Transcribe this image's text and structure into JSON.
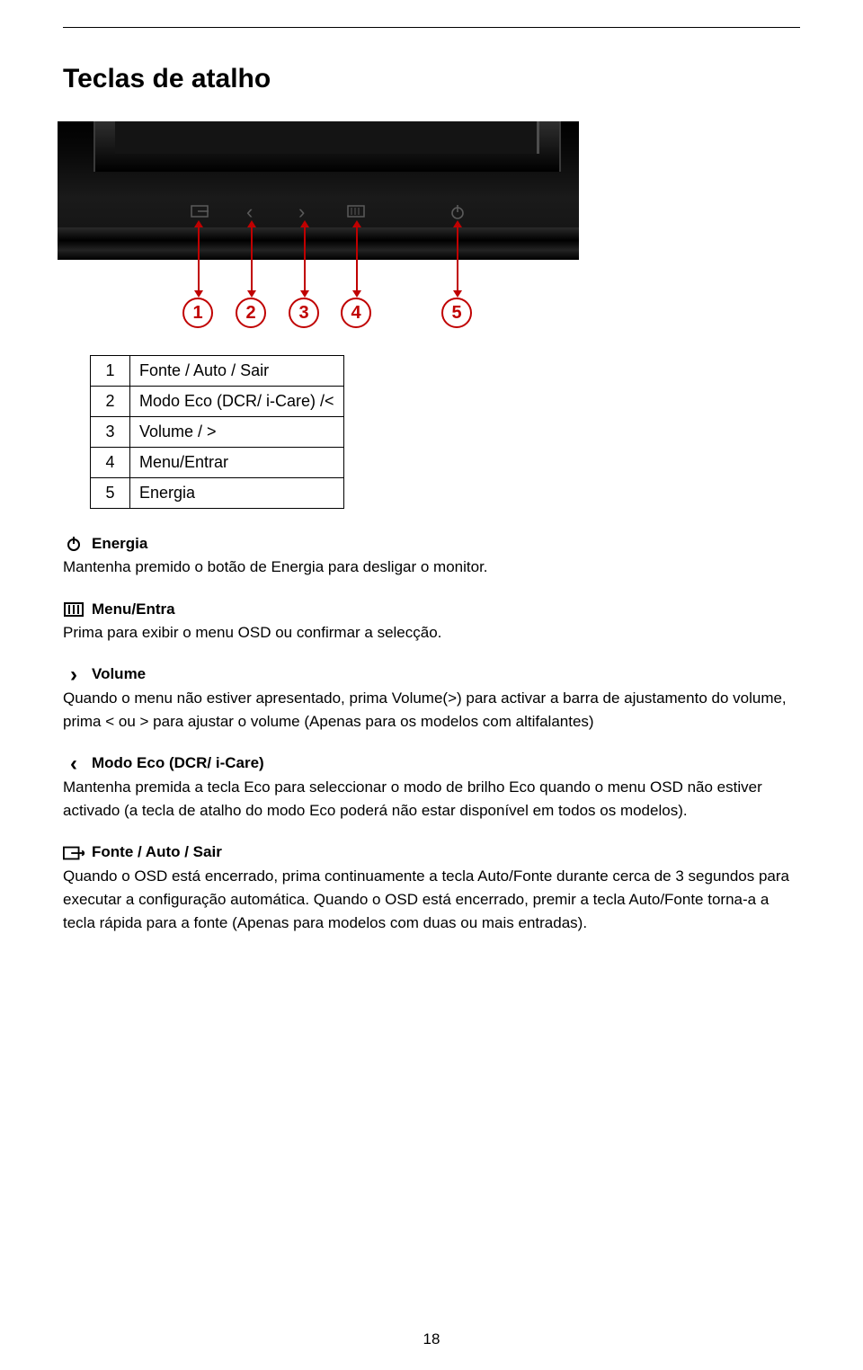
{
  "title": "Teclas de atalho",
  "callouts": [
    "1",
    "2",
    "3",
    "4",
    "5"
  ],
  "table": {
    "rows": [
      {
        "num": "1",
        "label": "Fonte / Auto / Sair"
      },
      {
        "num": "2",
        "label": "Modo Eco (DCR/ i-Care) /<"
      },
      {
        "num": "3",
        "label": "Volume / >"
      },
      {
        "num": "4",
        "label": "Menu/Entrar"
      },
      {
        "num": "5",
        "label": "Energia"
      }
    ]
  },
  "sections": {
    "energia": {
      "title": "Energia",
      "body": "Mantenha premido o botão de Energia para desligar o monitor."
    },
    "menu": {
      "title": "Menu/Entra",
      "body": "Prima para exibir o menu OSD ou confirmar a selecção."
    },
    "volume": {
      "title": "Volume",
      "body": "Quando o menu não estiver apresentado, prima Volume(>) para activar a barra de ajustamento do volume, prima < ou > para ajustar o volume (Apenas para os modelos com altifalantes)"
    },
    "eco": {
      "title": "Modo Eco (DCR/ i-Care)",
      "body": "Mantenha premida a tecla Eco para seleccionar o modo de brilho Eco quando o menu OSD não estiver activado (a tecla de atalho do modo Eco poderá não estar disponível em todos os modelos)."
    },
    "fonte": {
      "title": "Fonte / Auto / Sair",
      "body": "Quando o OSD está encerrado, prima continuamente a tecla Auto/Fonte durante cerca de 3 segundos para executar a configuração automática. Quando o OSD está encerrado, premir a tecla Auto/Fonte torna-a a tecla rápida para a fonte (Apenas para modelos com duas ou mais entradas)."
    }
  },
  "page_number": "18"
}
